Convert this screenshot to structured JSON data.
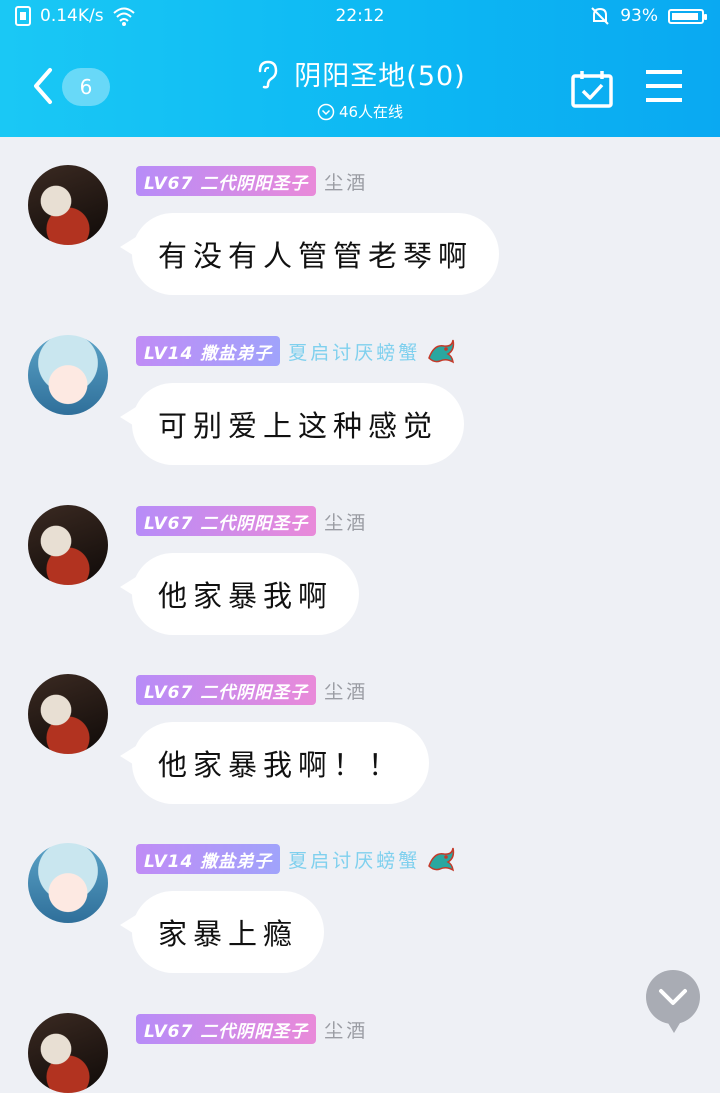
{
  "status_bar": {
    "speed": "0.14K/s",
    "time": "22:12",
    "battery": "93%",
    "battery_level": 0.93
  },
  "header": {
    "back_count": "6",
    "group_name": "阴阳圣地(50)",
    "online": "46人在线",
    "icons": [
      "back-chevron-icon",
      "ear-icon",
      "calendar-check-icon",
      "menu-icon"
    ]
  },
  "messages": [
    {
      "badge": "LV67 二代阴阳圣子",
      "user": "尘酒",
      "text": "有没有人管管老琴啊"
    },
    {
      "badge": "LV14 撒盐弟子",
      "user": "夏启讨厌螃蟹",
      "text": "可别爱上这种感觉"
    },
    {
      "badge": "LV67 二代阴阳圣子",
      "user": "尘酒",
      "text": "他家暴我啊"
    },
    {
      "badge": "LV67 二代阴阳圣子",
      "user": "尘酒",
      "text": "他家暴我啊！！"
    },
    {
      "badge": "LV14 撒盐弟子",
      "user": "夏启讨厌螃蟹",
      "text": "家暴上瘾"
    },
    {
      "badge": "LV67 二代阴阳圣子",
      "user": "尘酒",
      "text": ""
    }
  ],
  "colors": {
    "header_start": "#1ac8f5",
    "header_end": "#0aa9f2",
    "background": "#eef0f5",
    "bubble": "#ffffff"
  }
}
